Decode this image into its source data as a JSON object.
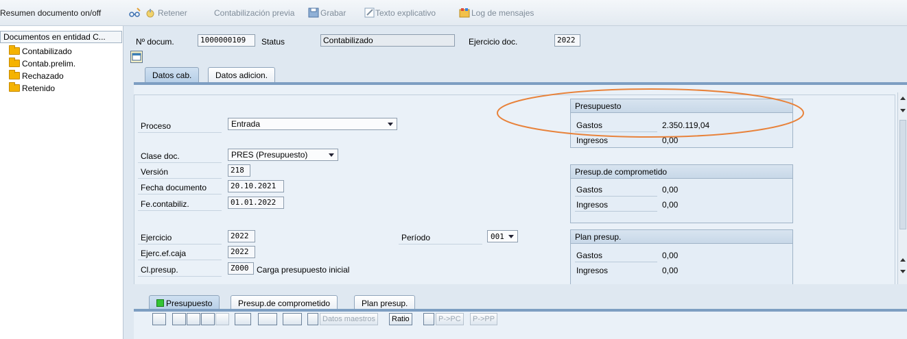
{
  "toolbar": {
    "title": "Resumen documento on/off",
    "retener": "Retener",
    "contab_previa": "Contabilización previa",
    "grabar": "Grabar",
    "texto_explicativo": "Texto explicativo",
    "log_mensajes": "Log de mensajes"
  },
  "tree": {
    "root": "Documentos en entidad C...",
    "items": [
      "Contabilizado",
      "Contab.prelim.",
      "Rechazado",
      "Retenido"
    ]
  },
  "header": {
    "nodoc_label": "Nº docum.",
    "nodoc_value": "1000000109",
    "status_label": "Status",
    "status_value": "Contabilizado",
    "ejercicio_label": "Ejercicio doc.",
    "ejercicio_value": "2022"
  },
  "tabs_top": [
    "Datos cab.",
    "Datos adicion."
  ],
  "form": {
    "proceso_label": "Proceso",
    "proceso_value": "Entrada",
    "clase_label": "Clase doc.",
    "clase_value": "PRES (Presupuesto)",
    "version_label": "Versión",
    "version_value": "218",
    "fecha_doc_label": "Fecha documento",
    "fecha_doc_value": "20.10.2021",
    "fe_contab_label": "Fe.contabiliz.",
    "fe_contab_value": "01.01.2022",
    "ejercicio_label": "Ejercicio",
    "ejercicio_value": "2022",
    "ejerc_caja_label": "Ejerc.ef.caja",
    "ejerc_caja_value": "2022",
    "periodo_label": "Período",
    "periodo_value": "001",
    "clpresup_label": "Cl.presup.",
    "clpresup_code": "Z000",
    "clpresup_desc": "Carga presupuesto inicial"
  },
  "groups": {
    "presupuesto": {
      "title": "Presupuesto",
      "gastos_label": "Gastos",
      "gastos": "2.350.119,04",
      "ingresos_label": "Ingresos",
      "ingresos": "0,00"
    },
    "comprometido": {
      "title": "Presup.de comprometido",
      "gastos_label": "Gastos",
      "gastos": "0,00",
      "ingresos_label": "Ingresos",
      "ingresos": "0,00"
    },
    "plan": {
      "title": "Plan presup.",
      "gastos_label": "Gastos",
      "gastos": "0,00",
      "ingresos_label": "Ingresos",
      "ingresos": "0,00"
    }
  },
  "tabs_bottom": [
    "Presupuesto",
    "Presup.de comprometido",
    "Plan presup."
  ],
  "bottom_toolbar": {
    "datos_maestros": "Datos maestros",
    "ratio": "Ratio",
    "p_pc": "P->PC",
    "p_pp": "P->PP"
  },
  "colors": {
    "highlight_ellipse": "#e8823a",
    "tab_strip": "#7d9ec2",
    "folder": "#f5b301"
  }
}
